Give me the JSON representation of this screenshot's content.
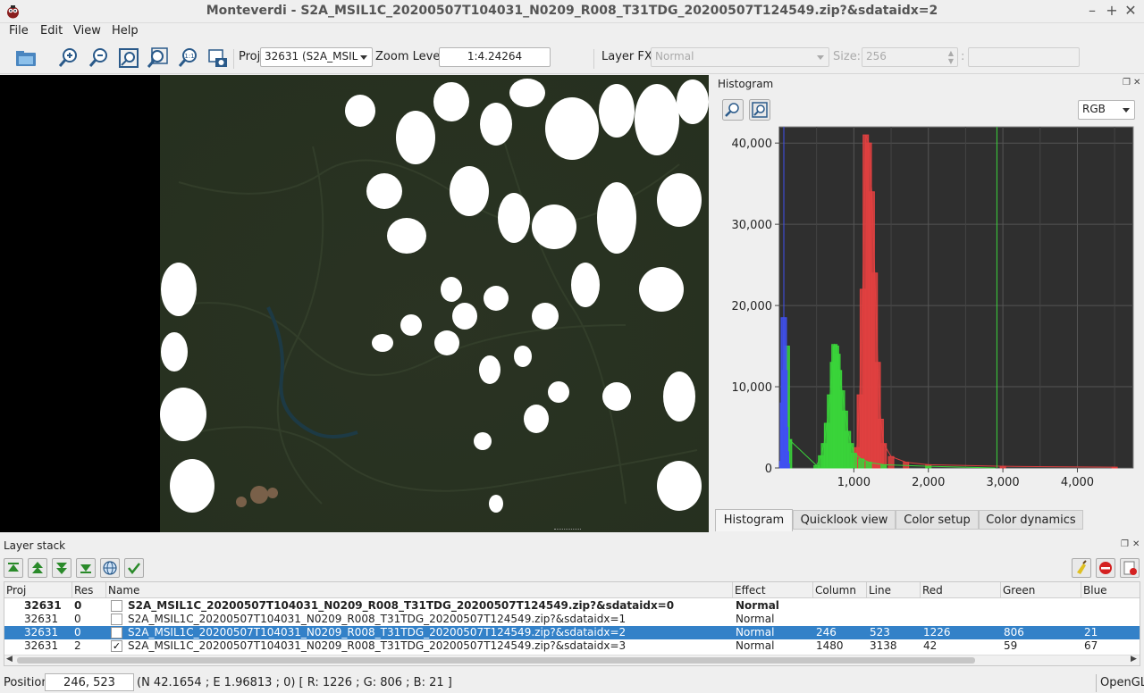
{
  "window": {
    "title": "Monteverdi - S2A_MSIL1C_20200507T104031_N0209_R008_T31TDG_20200507T124549.zip?&sdataidx=2"
  },
  "menubar": {
    "items": [
      "File",
      "Edit",
      "View",
      "Help"
    ]
  },
  "toolbar": {
    "proj_label": "Proj",
    "proj_value": "32631 (S2A_MSIL",
    "zoom_label": "Zoom Level",
    "zoom_value": "1:4.24264",
    "layerfx_label": "Layer FX",
    "layerfx_value": "Normal",
    "size_label": "Size:",
    "size_value": "256",
    "extra_label": ":"
  },
  "histogram": {
    "dock_title": "Histogram",
    "channel": "RGB",
    "tabs": [
      "Histogram",
      "Quicklook view",
      "Color setup",
      "Color dynamics"
    ],
    "active_tab": "Histogram",
    "y_ticks": [
      "40,000",
      "30,000",
      "20,000",
      "10,000",
      "0"
    ],
    "x_ticks": [
      "1,000",
      "2,000",
      "3,000",
      "4,000"
    ],
    "colors": {
      "red": "#e04040",
      "green": "#3ad43a",
      "blue": "#4050f0",
      "bg": "#2f2f2f"
    }
  },
  "chart_data": {
    "type": "bar",
    "title": "",
    "xlim": [
      0,
      4750
    ],
    "ylim": [
      0,
      42000
    ],
    "series": [
      {
        "color": "#e04040",
        "x": [
          1000,
          1040,
          1080,
          1120,
          1160,
          1200,
          1240,
          1280,
          1320,
          1360,
          1400,
          1500,
          1700,
          2000,
          3000,
          4500
        ],
        "values": [
          600,
          2500,
          9000,
          22000,
          41000,
          40000,
          34000,
          24000,
          13000,
          6000,
          3000,
          1400,
          700,
          400,
          200,
          100
        ]
      },
      {
        "color": "#3ad43a",
        "x": [
          60,
          80,
          100,
          130,
          500,
          560,
          600,
          640,
          680,
          720,
          740,
          760,
          780,
          800,
          840,
          880,
          920,
          960,
          1000,
          1100,
          1200,
          1400,
          2000,
          2900
        ],
        "values": [
          1500,
          3500,
          15000,
          3500,
          300,
          1500,
          3000,
          5500,
          9000,
          13000,
          15200,
          15000,
          14000,
          12000,
          9500,
          7000,
          4500,
          3000,
          1800,
          1100,
          700,
          400,
          200,
          0
        ]
      },
      {
        "color": "#4050f0",
        "x": [
          40,
          50,
          60,
          70,
          80,
          90,
          100
        ],
        "values": [
          800,
          8000,
          18500,
          12000,
          5000,
          2000,
          500
        ]
      }
    ],
    "markers": [
      {
        "color": "#4050f0",
        "x": 60
      },
      {
        "color": "#3ad43a",
        "x": 2920
      }
    ]
  },
  "layerstack": {
    "dock_title": "Layer stack",
    "columns": [
      "Proj",
      "Res",
      "Name",
      "Effect",
      "Column",
      "Line",
      "Red",
      "Green",
      "Blue"
    ],
    "rows": [
      {
        "proj": "32631",
        "res": "0",
        "checked": "",
        "name": "S2A_MSIL1C_20200507T104031_N0209_R008_T31TDG_20200507T124549.zip?&sdataidx=0",
        "effect": "Normal",
        "column": "",
        "line": "",
        "red": "",
        "green": "",
        "blue": ""
      },
      {
        "proj": "32631",
        "res": "0",
        "checked": "",
        "name": "S2A_MSIL1C_20200507T104031_N0209_R008_T31TDG_20200507T124549.zip?&sdataidx=1",
        "effect": "Normal",
        "column": "",
        "line": "",
        "red": "",
        "green": "",
        "blue": ""
      },
      {
        "proj": "32631",
        "res": "0",
        "checked": "",
        "name": "S2A_MSIL1C_20200507T104031_N0209_R008_T31TDG_20200507T124549.zip?&sdataidx=2",
        "effect": "Normal",
        "column": "246",
        "line": "523",
        "red": "1226",
        "green": "806",
        "blue": "21"
      },
      {
        "proj": "32631",
        "res": "2",
        "checked": "✓",
        "name": "S2A_MSIL1C_20200507T104031_N0209_R008_T31TDG_20200507T124549.zip?&sdataidx=3",
        "effect": "Normal",
        "column": "1480",
        "line": "3138",
        "red": "42",
        "green": "59",
        "blue": "67"
      }
    ]
  },
  "status": {
    "position_label": "Position",
    "position_value": "246, 523",
    "info": "(N 42.1654 ; E 1.96813 ; 0) [ R: 1226 ; G: 806 ; B: 21 ]",
    "renderer": "OpenGL"
  }
}
